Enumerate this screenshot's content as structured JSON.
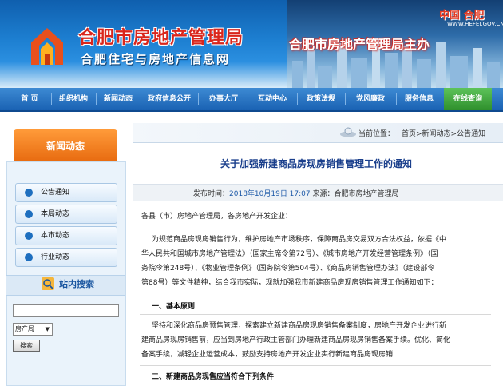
{
  "banner": {
    "title": "合肥市房地产管理局",
    "subtitle": "合肥住宅与房地产信息网",
    "city_name": "中国 合肥",
    "city_url": "WWW.HEFEI.GOV.CN",
    "host_text": "合肥市房地产管理局主办"
  },
  "nav": {
    "items": [
      "首 页",
      "组织机构",
      "新闻动态",
      "政府信息公开",
      "办事大厅",
      "互动中心",
      "政策法规",
      "党风廉政",
      "服务信息",
      "在线查询"
    ]
  },
  "sidebar": {
    "header": "新闻动态",
    "items": [
      "公告通知",
      "本局动态",
      "本市动态",
      "行业动态"
    ],
    "search": {
      "title": "站内搜索",
      "select_value": "房产局",
      "button": "搜索"
    }
  },
  "breadcrumb": {
    "label": "当前位置：",
    "path": "首页>新闻动态>公告通知"
  },
  "article": {
    "title": "关于加强新建商品房现房销售管理工作的通知",
    "meta_prefix": "发布时间：",
    "meta_date": "2018年10月19日 17:07",
    "meta_source": "来源：合肥市房地产管理局",
    "greeting": "各县（市）房地产管理局，各房地产开发企业：",
    "intro_lines": [
      "为规范商品房现房销售行为，维护房地产市场秩序，保障商品房交易双方合法权益，依据《中",
      "华人民共和国城市房地产管理法》（国家主席令第72号）、《城市房地产开发经营管理条例》（国",
      "务院令第248号）、《物业管理条例》（国务院令第504号）、《商品房销售管理办法》（建设部令",
      "第88号）等文件精神，结合我市实际，现就加强我市新建商品房现房销售管理工作通知如下："
    ],
    "section1_title": "一、基本原则",
    "section1_lines": [
      "坚持和深化商品房预售管理，探索建立新建商品房现房销售备案制度，房地产开发企业进行新",
      "建商品房现房销售前，应当到房地产行政主管部门办理新建商品房现房销售备案手续。优化、简化",
      "备案手续，减轻企业运营成本，鼓励支持房地产开发企业实行新建商品房现房销"
    ],
    "section2_title": "二、新建商品房现售应当符合下列条件"
  }
}
